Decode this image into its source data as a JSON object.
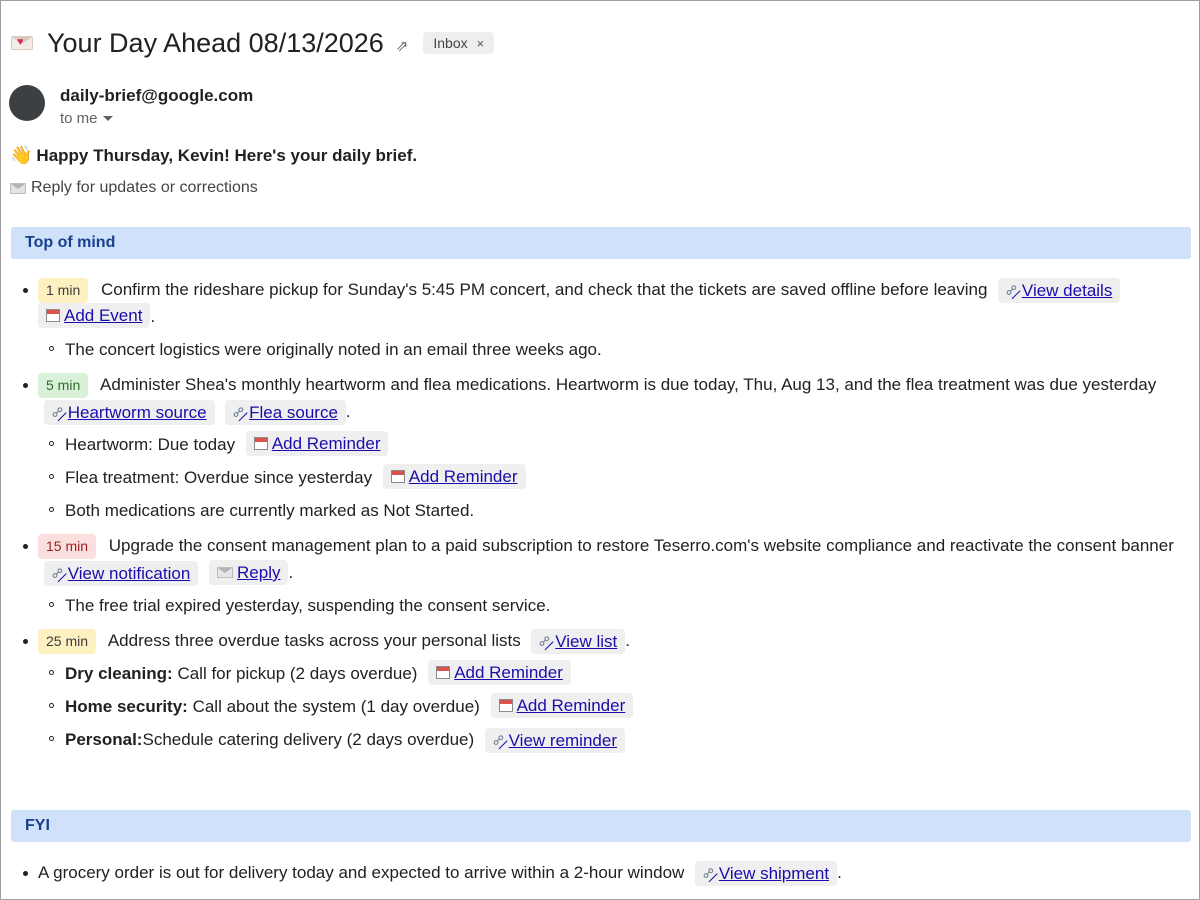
{
  "header": {
    "subject": "Your Day Ahead 08/13/2026",
    "label_chip": "Inbox",
    "label_chip_close": "×"
  },
  "sender": {
    "email": "daily-brief@google.com",
    "recipient": "to me"
  },
  "body": {
    "greeting": "Happy Thursday, Kevin! Here's your daily brief.",
    "reply_note": "Reply for updates or corrections"
  },
  "sections": {
    "top_of_mind": {
      "title": "Top of mind",
      "items": [
        {
          "badge": "1 min",
          "text": "Confirm the rideshare pickup for Sunday's 5:45 PM concert, and check that the tickets are saved offline before leaving",
          "links": [
            "View details",
            "Add Event"
          ],
          "subitems": [
            {
              "text": "The concert logistics were originally noted in an email three weeks ago."
            }
          ]
        },
        {
          "badge": "5 min",
          "text": "Administer Shea's monthly heartworm and flea medications. Heartworm is due today, Thu, Aug 13, and the flea treatment was due yesterday",
          "links": [
            "Heartworm source",
            "Flea source"
          ],
          "subitems": [
            {
              "text": "Heartworm: Due today",
              "link": "Add Reminder"
            },
            {
              "text": "Flea treatment: Overdue since yesterday",
              "link": "Add Reminder"
            },
            {
              "text": "Both medications are currently marked as Not Started."
            }
          ]
        },
        {
          "badge": "15 min",
          "text": "Upgrade the consent management plan to a paid subscription to restore Teserro.com's website compliance and reactivate the consent banner",
          "links": [
            "View notification",
            "Reply"
          ],
          "subitems": [
            {
              "text": "The free trial expired yesterday, suspending the consent service."
            }
          ]
        },
        {
          "badge": "25 min",
          "text": "Address three overdue tasks across your personal lists",
          "links": [
            "View list"
          ],
          "subitems": [
            {
              "label": "Dry cleaning:",
              "text": "Call for pickup (2 days overdue)",
              "link": "Add Reminder"
            },
            {
              "label": "Home security:",
              "text": "Call about the system (1 day overdue)",
              "link": "Add Reminder"
            },
            {
              "label": "Personal:",
              "text": "Schedule catering delivery (2 days overdue)",
              "link": "View reminder"
            }
          ]
        }
      ]
    },
    "fyi": {
      "title": "FYI",
      "items": [
        {
          "text": "A grocery order is out for delivery today and expected to arrive within a 2-hour window",
          "link": "View shipment"
        }
      ]
    }
  },
  "colors": {
    "section_bg": "#cfe2fa",
    "section_text": "#1a3f8c",
    "link": "#1a0dab",
    "badge_yellow": "#fdf1c2",
    "badge_green": "#d9f0d9",
    "badge_red": "#fbdfdf"
  },
  "punctuation": "."
}
